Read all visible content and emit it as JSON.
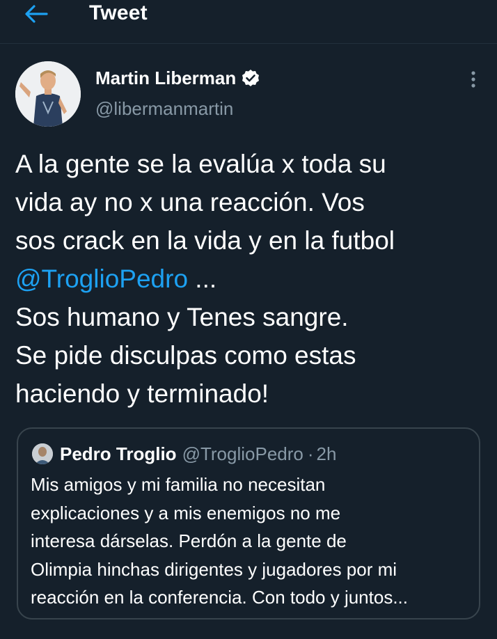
{
  "header": {
    "title": "Tweet",
    "back_icon": "arrow-left-icon",
    "accent_color": "#1da1f2"
  },
  "tweet": {
    "author": {
      "name": "Martin Liberman",
      "handle": "@libermanmartin",
      "verified": true
    },
    "more_icon": "more-vertical-icon",
    "text_lines": [
      "A la gente se la evalúa x toda su",
      "vida ay no x una reacción. Vos",
      "sos crack en la vida y en la futbol"
    ],
    "mention": "@TroglioPedro",
    "mention_suffix": " ...",
    "text_lines_after": [
      "Sos humano y Tenes sangre.",
      "Se pide disculpas como estas",
      "haciendo y terminado!"
    ]
  },
  "quoted_tweet": {
    "name": "Pedro Troglio",
    "handle": "@TroglioPedro",
    "separator": "·",
    "time": "2h",
    "text_lines": [
      "Mis amigos y mi familia no necesitan",
      "explicaciones y a mis enemigos no me",
      "interesa dárselas. Perdón a la gente de",
      "Olimpia hinchas dirigentes y jugadores por mi",
      "reacción en la conferencia. Con todo y juntos..."
    ]
  },
  "colors": {
    "background": "#15202b",
    "text": "#ffffff",
    "secondary_text": "#8899a6",
    "link": "#1da1f2",
    "border": "#38444d"
  }
}
